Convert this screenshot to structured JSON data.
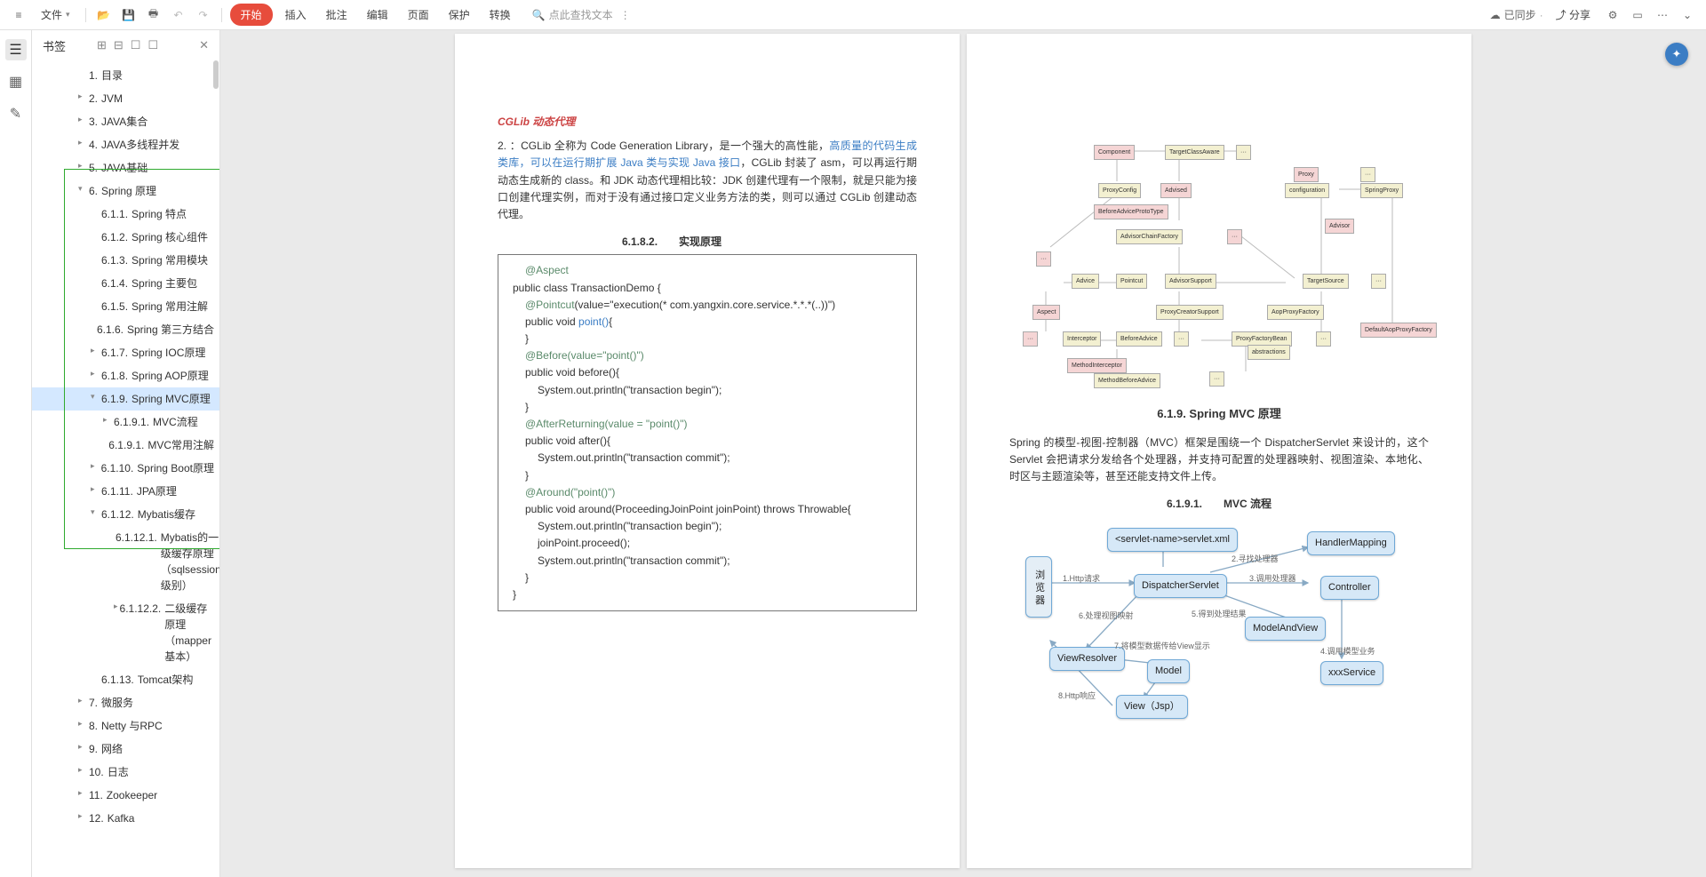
{
  "toolbar": {
    "file": "文件",
    "start": "开始",
    "insert": "插入",
    "comment": "批注",
    "edit": "编辑",
    "page": "页面",
    "protect": "保护",
    "convert": "转换",
    "search_placeholder": "点此查找文本",
    "sync": "已同步",
    "share": "分享"
  },
  "sidebar": {
    "title": "书签",
    "items": [
      {
        "lv": 1,
        "chev": "",
        "num": "1.",
        "label": "目录"
      },
      {
        "lv": 1,
        "chev": "▸",
        "num": "2.",
        "label": "JVM"
      },
      {
        "lv": 1,
        "chev": "▸",
        "num": "3.",
        "label": "JAVA集合"
      },
      {
        "lv": 1,
        "chev": "▸",
        "num": "4.",
        "label": "JAVA多线程并发"
      },
      {
        "lv": 1,
        "chev": "▸",
        "num": "5.",
        "label": "JAVA基础"
      },
      {
        "lv": 1,
        "chev": "▾",
        "num": "6.",
        "label": "Spring 原理"
      },
      {
        "lv": 2,
        "chev": "",
        "num": "6.1.1.",
        "label": "Spring 特点"
      },
      {
        "lv": 2,
        "chev": "",
        "num": "6.1.2.",
        "label": "Spring 核心组件"
      },
      {
        "lv": 2,
        "chev": "",
        "num": "6.1.3.",
        "label": "Spring 常用模块"
      },
      {
        "lv": 2,
        "chev": "",
        "num": "6.1.4.",
        "label": "Spring 主要包"
      },
      {
        "lv": 2,
        "chev": "",
        "num": "6.1.5.",
        "label": "Spring 常用注解"
      },
      {
        "lv": 2,
        "chev": "",
        "num": "6.1.6.",
        "label": "Spring 第三方结合"
      },
      {
        "lv": 2,
        "chev": "▸",
        "num": "6.1.7.",
        "label": "Spring IOC原理"
      },
      {
        "lv": 2,
        "chev": "▸",
        "num": "6.1.8.",
        "label": "Spring AOP原理"
      },
      {
        "lv": 2,
        "chev": "▾",
        "num": "6.1.9.",
        "label": "Spring MVC原理",
        "sel": true
      },
      {
        "lv": 3,
        "chev": "▸",
        "num": "6.1.9.1.",
        "label": "MVC流程"
      },
      {
        "lv": 3,
        "chev": "",
        "num": "6.1.9.1.",
        "label": "MVC常用注解"
      },
      {
        "lv": 2,
        "chev": "▸",
        "num": "6.1.10.",
        "label": "Spring Boot原理"
      },
      {
        "lv": 2,
        "chev": "▸",
        "num": "6.1.11.",
        "label": "JPA原理"
      },
      {
        "lv": 2,
        "chev": "▾",
        "num": "6.1.12.",
        "label": "Mybatis缓存"
      },
      {
        "lv": 4,
        "chev": "",
        "num": "6.1.12.1.",
        "label": "Mybatis的一级缓存原理（sqlsession级别）"
      },
      {
        "lv": 4,
        "chev": "▸",
        "num": "6.1.12.2.",
        "label": "二级缓存原理（mapper基本）"
      },
      {
        "lv": 2,
        "chev": "",
        "num": "6.1.13.",
        "label": "Tomcat架构"
      },
      {
        "lv": 1,
        "chev": "▸",
        "num": "7.",
        "label": "微服务"
      },
      {
        "lv": 1,
        "chev": "▸",
        "num": "8.",
        "label": "Netty 与RPC"
      },
      {
        "lv": 1,
        "chev": "▸",
        "num": "9.",
        "label": "网络"
      },
      {
        "lv": 1,
        "chev": "▸",
        "num": "10.",
        "label": "日志"
      },
      {
        "lv": 1,
        "chev": "▸",
        "num": "11.",
        "label": "Zookeeper"
      },
      {
        "lv": 1,
        "chev": "▸",
        "num": "12.",
        "label": "Kafka"
      }
    ]
  },
  "left_page": {
    "cglib_title": "CGLib 动态代理",
    "cglib_para_prefix": "2. ：CGLib 全称为 Code Generation Library，是一个强大的高性能，",
    "cglib_blue1": "高质量的代码生成类库，可以在运行期扩展 Java 类与实现 Java 接口",
    "cglib_para_suffix": "，CGLib 封装了 asm，可以再运行期动态生成新的 class。和 JDK 动态代理相比较：JDK 创建代理有一个限制，就是只能为接口创建代理实例，而对于没有通过接口定义业务方法的类，则可以通过 CGLib 创建动态代理。",
    "section_6182": "6.1.8.2.　　实现原理",
    "code": [
      {
        "cls": "ind1",
        "anno": "@Aspect"
      },
      {
        "cls": "",
        "txt": "public class TransactionDemo {"
      },
      {
        "cls": "ind1",
        "anno": "@Pointcut",
        "txt": "(value=\"execution(* com.yangxin.core.service.*.*.*(..))\")"
      },
      {
        "cls": "ind1",
        "txt": "public void ",
        "kw": "point()",
        "txt2": "{"
      },
      {
        "cls": "ind1",
        "txt": "}"
      },
      {
        "cls": "ind1",
        "anno": "@Before(value=\"point()\")"
      },
      {
        "cls": "ind1",
        "txt": "public void before(){"
      },
      {
        "cls": "ind2",
        "txt": "System.out.println(\"transaction begin\");"
      },
      {
        "cls": "ind1",
        "txt": "}"
      },
      {
        "cls": "ind1",
        "anno": "@AfterReturning(value = \"point()\")"
      },
      {
        "cls": "ind1",
        "txt": "public void after(){"
      },
      {
        "cls": "ind2",
        "txt": "System.out.println(\"transaction commit\");"
      },
      {
        "cls": "ind1",
        "txt": "}"
      },
      {
        "cls": "ind1",
        "anno": "@Around(\"point()\")"
      },
      {
        "cls": "ind1",
        "txt": "public void around(ProceedingJoinPoint joinPoint) throws Throwable{"
      },
      {
        "cls": "ind2",
        "txt": "System.out.println(\"transaction begin\");"
      },
      {
        "cls": "ind2",
        "txt": "joinPoint.proceed();"
      },
      {
        "cls": "ind2",
        "txt": "System.out.println(\"transaction commit\");"
      },
      {
        "cls": "ind1",
        "txt": "}"
      },
      {
        "cls": "",
        "txt": "}"
      }
    ]
  },
  "right_page": {
    "h_619": "6.1.9. Spring MVC 原理",
    "p_619": "Spring 的模型-视图-控制器（MVC）框架是围绕一个 DispatcherServlet 来设计的，这个 Servlet 会把请求分发给各个处理器，并支持可配置的处理器映射、视图渲染、本地化、时区与主题渲染等，甚至还能支持文件上传。",
    "h_6191": "6.1.9.1.　　MVC 流程",
    "mvc_nodes": {
      "browser": "浏\n览\n器",
      "servletxml": "<servlet-name>servlet.xml",
      "handlermapping": "HandlerMapping",
      "dispatcher": "DispatcherServlet",
      "controller": "Controller",
      "modelandview": "ModelAndView",
      "viewresolver": "ViewResolver",
      "model": "Model",
      "xxxservice": "xxxService",
      "viewjsp": "View（Jsp）"
    },
    "mvc_labels": {
      "l1": "1.Http请求",
      "l2": "2.寻找处理器",
      "l3": "3.调用处理器",
      "l4": "4.调用模型业务",
      "l5": "5.得到处理结果",
      "l6": "6.处理视图映射",
      "l7": "7.将模型数据传给View显示",
      "l8": "8.Http响应"
    }
  }
}
